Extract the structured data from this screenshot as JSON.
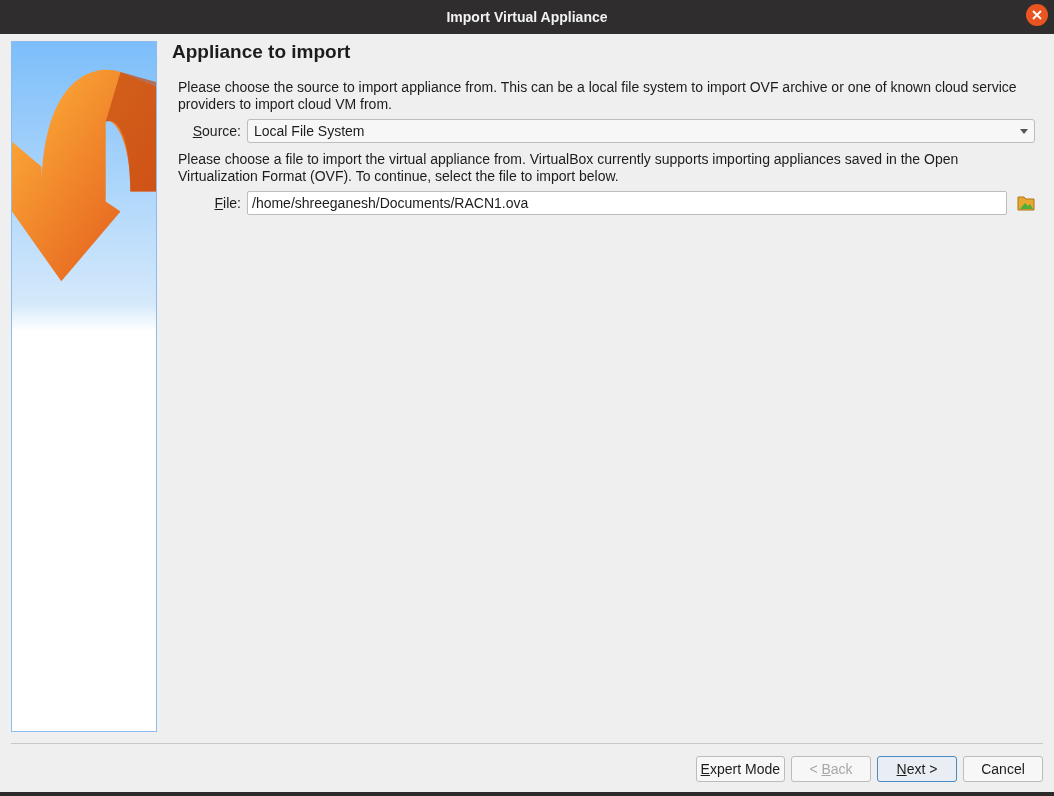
{
  "window": {
    "title": "Import Virtual Appliance"
  },
  "page": {
    "title": "Appliance to import"
  },
  "intro": "Please choose the source to import appliance from. This can be a local file system to import OVF archive or one of known cloud service providers to import cloud VM from.",
  "source": {
    "label": {
      "key": "S",
      "after": "ource:"
    },
    "value": "Local File System"
  },
  "file_hint": "Please choose a file to import the virtual appliance from. VirtualBox currently supports importing appliances saved in the Open Virtualization Format (OVF). To continue, select the file to import below.",
  "file": {
    "label": {
      "key": "F",
      "after": "ile:"
    },
    "value": "/home/shreeganesh/Documents/RACN1.ova"
  },
  "buttons": [
    {
      "label": {
        "key": "E",
        "after": "xpert Mode"
      },
      "disabled": false,
      "default": false
    },
    {
      "label": {
        "before": "< ",
        "key": "B",
        "after": "ack"
      },
      "disabled": true,
      "default": false
    },
    {
      "label": {
        "key": "N",
        "after": "ext >"
      },
      "disabled": false,
      "default": true
    },
    {
      "label": {
        "before": "Cancel"
      },
      "disabled": false,
      "default": false
    }
  ]
}
